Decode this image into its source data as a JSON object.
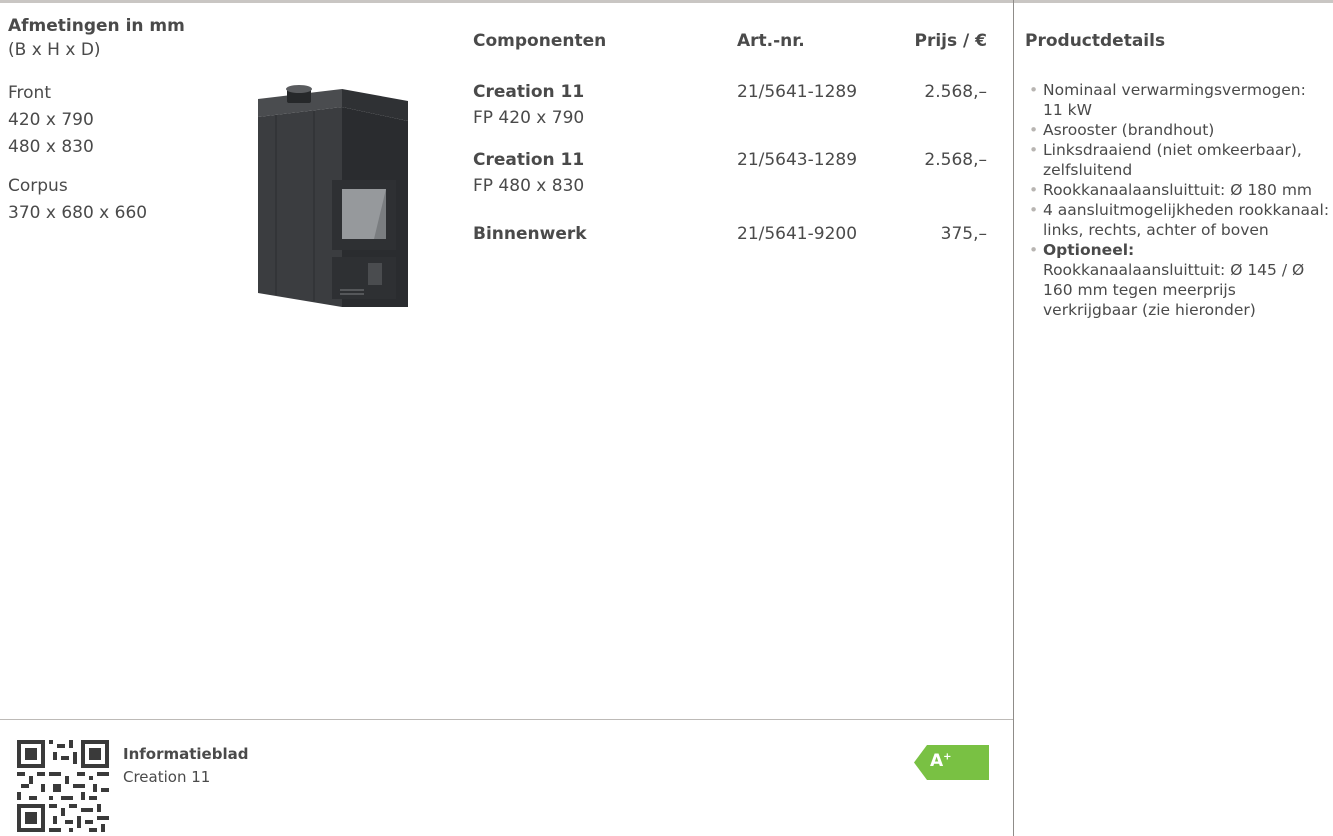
{
  "header": {
    "dimensions_title": "Afmetingen in mm",
    "dimensions_sub": "(B x H x D)",
    "components": "Componenten",
    "article_nr": "Art.-nr.",
    "price": "Prijs / €",
    "product_details": "Productdetails"
  },
  "dimensions": {
    "front_label": "Front",
    "front_1": "420 x 790",
    "front_2": "480 x 830",
    "corpus_label": "Corpus",
    "corpus": "370 x 680 x 660"
  },
  "rows": [
    {
      "name": "Creation 11",
      "sub": "FP 420 x 790",
      "art": "21/5641-1289",
      "price": "2.568,–"
    },
    {
      "name": "Creation 11",
      "sub": "FP 480 x 830",
      "art": "21/5643-1289",
      "price": "2.568,–"
    },
    {
      "name": "Binnenwerk",
      "sub": "",
      "art": "21/5641-9200",
      "price": "375,–"
    }
  ],
  "details": {
    "item1": "Nominaal verwarmingsvermogen: 11 kW",
    "item2": "Asrooster (brandhout)",
    "item3": "Linksdraaiend (niet omkeerbaar), zelfsluitend",
    "item4": "Rookkanaalaansluittuit: Ø 180 mm",
    "item5": "4 aansluitmogelijkheden rookkanaal: links, rechts, achter of boven",
    "optional_label": "Optioneel:",
    "optional_text": "Rookkanaalaansluittuit: Ø 145 / Ø 160 mm tegen meerprijs verkrijgbaar (zie hieronder)"
  },
  "infoblad": {
    "title": "Informatieblad",
    "subtitle": "Creation 11"
  },
  "energy": {
    "class": "A",
    "plus": "+",
    "color": "#79c143"
  },
  "colors": {
    "text": "#4a4a4a",
    "rule": "#c9c6c3",
    "bullet": "#b8b5b2",
    "stove": "#3e4043"
  },
  "icons": {
    "qr": "qr-code-icon",
    "energy": "energy-label-icon"
  }
}
